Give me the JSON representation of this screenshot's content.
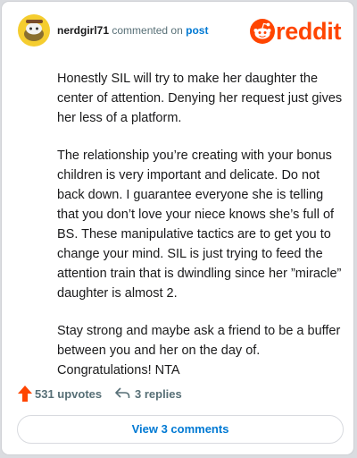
{
  "comment": {
    "username": "nerdgirl71",
    "action_text": "commented on",
    "post_link": "post",
    "paragraphs": [
      "Honestly SIL will try to make her daughter the center of attention. Denying her request just gives her less of a platform.",
      "The relationship you’re creating with your bonus children is very important and delicate. Do not back down. I guarantee everyone she is telling that you don’t love your niece knows she’s full of BS. These manipulative tactics are to get you to change your mind. SIL is just trying to feed the attention train that is dwindling since her ”miracle” daughter is almost 2.",
      "Stay strong and maybe ask a friend to be a buffer between you and her on the day of. Congratulations! NTA"
    ]
  },
  "brand": {
    "logo_text": "reddit",
    "color": "#ff4500"
  },
  "footer": {
    "upvotes": "531 upvotes",
    "replies": "3 replies",
    "view_button": "View 3 comments"
  },
  "icons": {
    "avatar": "snoo-avatar-icon",
    "logo": "reddit-snoo-icon",
    "upvote": "upvote-arrow-icon",
    "reply": "reply-arrow-icon"
  },
  "colors": {
    "accent_blue": "#0079d3",
    "muted_text": "#576f76",
    "upvote": "#ff4500"
  }
}
